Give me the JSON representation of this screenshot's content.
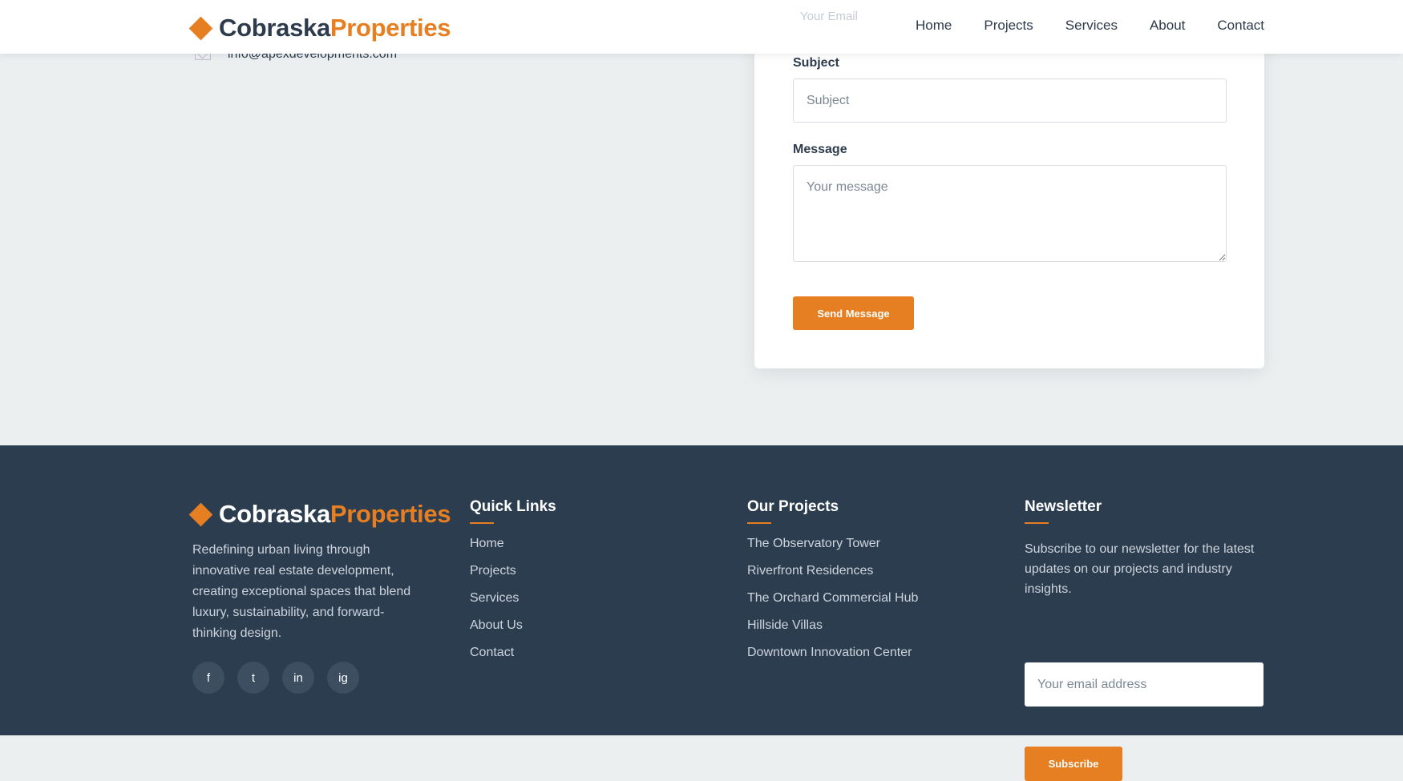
{
  "brand": {
    "part1": "Cobraska",
    "part2": "Properties",
    "accent_color": "#e67e22",
    "dark_color": "#2d3b4d"
  },
  "nav": {
    "items": [
      "Home",
      "Projects",
      "Services",
      "About",
      "Contact"
    ]
  },
  "contact": {
    "email": "info@apexdevelopments.com",
    "partial_label": "Your Email"
  },
  "form": {
    "subject_label": "Subject",
    "subject_placeholder": "Subject",
    "message_label": "Message",
    "message_placeholder": "Your message",
    "submit_label": "Send Message"
  },
  "footer": {
    "about": "Redefining urban living through innovative real estate development, creating exceptional spaces that blend luxury, sustainability, and forward-thinking design.",
    "socials": [
      "f",
      "t",
      "in",
      "ig"
    ],
    "quick_links": {
      "title": "Quick Links",
      "items": [
        "Home",
        "Projects",
        "Services",
        "About Us",
        "Contact"
      ]
    },
    "projects": {
      "title": "Our Projects",
      "items": [
        "The Observatory Tower",
        "Riverfront Residences",
        "The Orchard Commercial Hub",
        "Hillside Villas",
        "Downtown Innovation Center"
      ]
    },
    "newsletter": {
      "title": "Newsletter",
      "text": "Subscribe to our newsletter for the latest updates on our projects and industry insights.",
      "email_placeholder": "Your email address",
      "button_label": "Subscribe"
    },
    "background_color": "#2c3d50"
  }
}
